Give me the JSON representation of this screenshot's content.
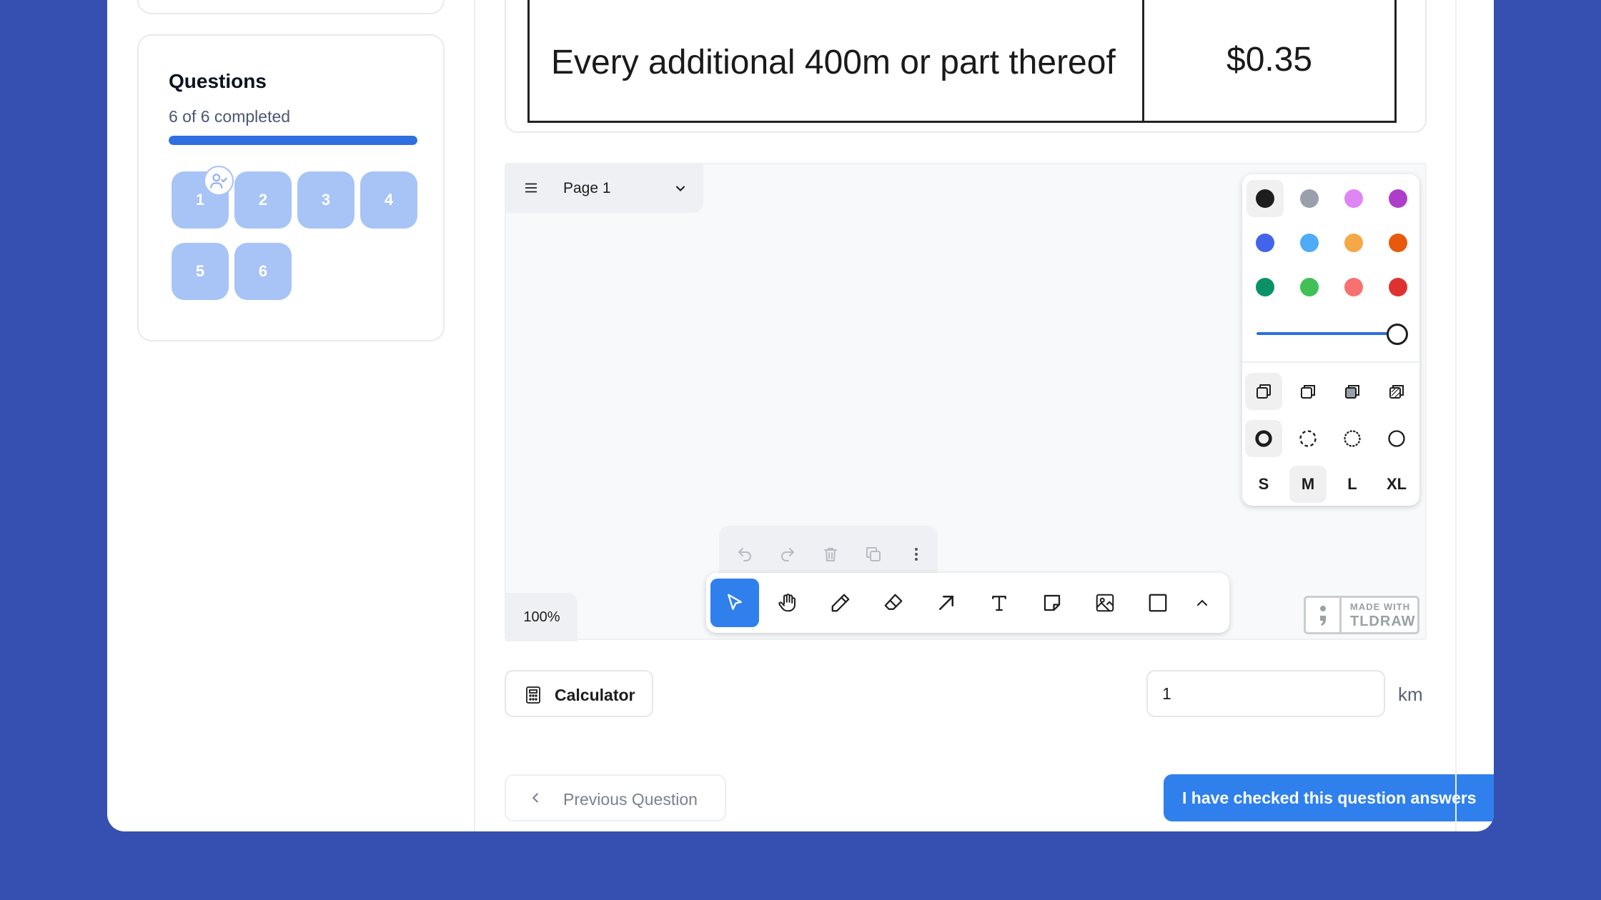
{
  "sidebar": {
    "questions_title": "Questions",
    "completed_text": "6 of 6 completed",
    "progress_fraction": 1.0,
    "question_buttons": [
      "1",
      "2",
      "3",
      "4",
      "5",
      "6"
    ]
  },
  "document": {
    "row_label": "Every additional 400m or part thereof",
    "row_value": "$0.35"
  },
  "canvas": {
    "page_label": "Page 1",
    "zoom": "100%",
    "made_with_line1": "MADE WITH",
    "made_with_line2": "TLDRAW",
    "colors": [
      "#1d1d1d",
      "#9aa0ab",
      "#e085f4",
      "#ae3ec9",
      "#4263eb",
      "#4dabf7",
      "#f4a847",
      "#e8590c",
      "#099268",
      "#40c057",
      "#f87171",
      "#e03131"
    ],
    "sizes": [
      "S",
      "M",
      "L",
      "XL"
    ],
    "selected_size": "M"
  },
  "controls": {
    "calculator_label": "Calculator",
    "answer_value": "1",
    "answer_unit": "km",
    "prev_label": "Previous Question",
    "next_label": "I have checked this question answers"
  }
}
